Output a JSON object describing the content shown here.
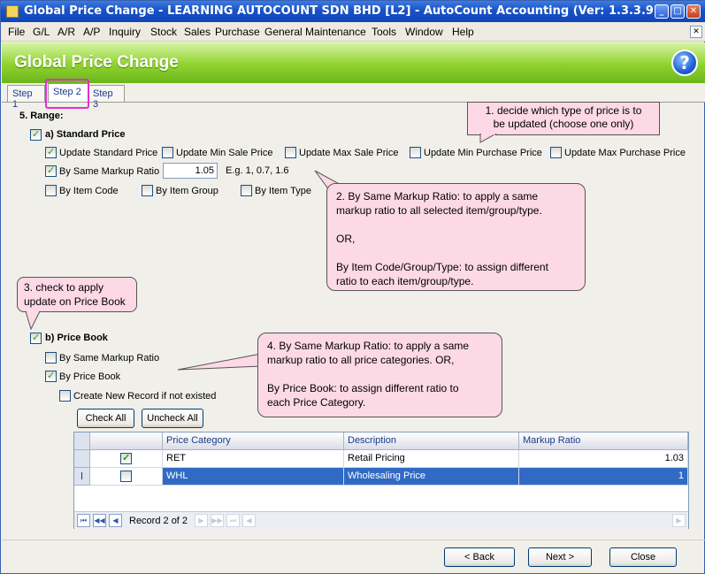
{
  "window": {
    "title": "Global Price Change - LEARNING AUTOCOUNT SDN BHD [L2] - AutoCount Accounting (Ver: 1.3.3.9)"
  },
  "menu": [
    "File",
    "G/L",
    "A/R",
    "A/P",
    "Inquiry",
    "Stock",
    "Sales",
    "Purchase",
    "General Maintenance",
    "Tools",
    "Window",
    "Help"
  ],
  "header": {
    "title": "Global Price Change",
    "help": "?"
  },
  "tabs": [
    "Step 1",
    "Step 2",
    "Step 3"
  ],
  "range": {
    "heading": "5. Range:",
    "standard_price": {
      "label": "a) Standard Price",
      "checked": true,
      "update_standard": "Update Standard Price",
      "update_min_sale": "Update Min Sale Price",
      "update_max_sale": "Update Max Sale Price",
      "update_min_purchase": "Update Min Purchase Price",
      "update_max_purchase": "Update Max Purchase Price",
      "same_markup": "By Same Markup Ratio",
      "ratio_value": "1.05",
      "example": "E.g. 1, 0.7, 1.6",
      "by_item_code": "By Item Code",
      "by_item_group": "By Item Group",
      "by_item_type": "By Item Type"
    },
    "price_book": {
      "label": "b) Price Book",
      "same_markup": "By Same Markup Ratio",
      "by_price_book": "By Price Book",
      "create_new": "Create New Record if not existed",
      "check_all": "Check All",
      "uncheck_all": "Uncheck All"
    }
  },
  "callouts": {
    "c1": [
      "1. decide which type of price is to",
      "be updated (choose one only)"
    ],
    "c2": [
      "2. By Same Markup Ratio: to apply a same",
      "markup ratio to all selected item/group/type.",
      "",
      "OR,",
      "",
      "By Item Code/Group/Type: to assign different",
      "ratio to each item/group/type."
    ],
    "c3": [
      "3. check to apply",
      "update on Price Book"
    ],
    "c4": [
      "4. By Same Markup Ratio: to apply a same",
      "markup ratio to all price categories.    OR,",
      "",
      "By Price Book: to assign different ratio to",
      "each Price Category."
    ]
  },
  "grid": {
    "columns": [
      "Price Category",
      "Description",
      "Markup Ratio"
    ],
    "rows": [
      {
        "checked": true,
        "category": "RET",
        "description": "Retail Pricing",
        "ratio": "1.03"
      },
      {
        "checked": false,
        "category": "WHL",
        "description": "Wholesaling Price",
        "ratio": "1"
      }
    ],
    "row_indicator": "I",
    "record": "Record 2 of 2"
  },
  "buttons": {
    "back": "< Back",
    "next": "Next >",
    "close": "Close"
  }
}
